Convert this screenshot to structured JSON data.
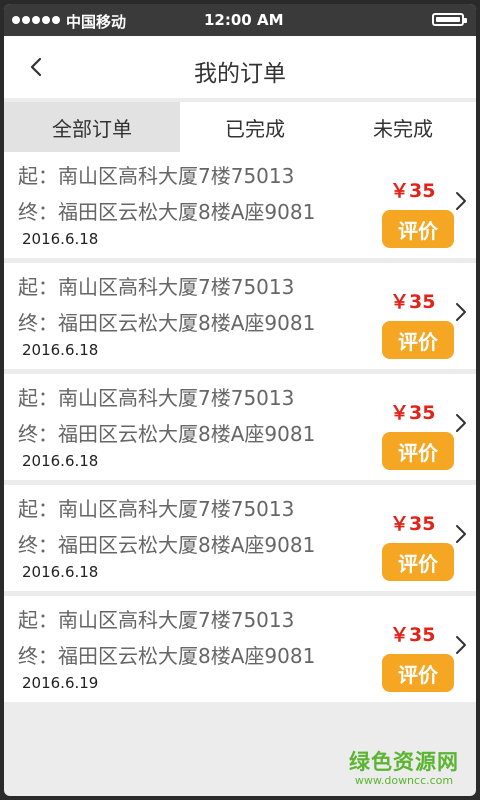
{
  "status_bar": {
    "carrier": "中国移动",
    "time": "12:00 AM",
    "battery_level": 1.0
  },
  "header": {
    "back_icon": "chevron-left-icon",
    "title": "我的订单"
  },
  "tabs": [
    {
      "label": "全部订单",
      "active": true
    },
    {
      "label": "已完成",
      "active": false
    },
    {
      "label": "未完成",
      "active": false
    }
  ],
  "orders": [
    {
      "from": "起：南山区高科大厦7楼75013",
      "to": "终：福田区云松大厦8楼A座9081",
      "date": "2016.6.18",
      "price": "￥35",
      "action": "评价"
    },
    {
      "from": "起：南山区高科大厦7楼75013",
      "to": "终：福田区云松大厦8楼A座9081",
      "date": "2016.6.18",
      "price": "￥35",
      "action": "评价"
    },
    {
      "from": "起：南山区高科大厦7楼75013",
      "to": "终：福田区云松大厦8楼A座9081",
      "date": "2016.6.18",
      "price": "￥35",
      "action": "评价"
    },
    {
      "from": "起：南山区高科大厦7楼75013",
      "to": "终：福田区云松大厦8楼A座9081",
      "date": "2016.6.18",
      "price": "￥35",
      "action": "评价"
    },
    {
      "from": "起：南山区高科大厦7楼75013",
      "to": "终：福田区云松大厦8楼A座9081",
      "date": "2016.6.19",
      "price": "￥35",
      "action": "评价"
    }
  ],
  "watermark": {
    "main": "绿色资源网",
    "sub": "www.downcc.com"
  },
  "colors": {
    "price": "#e2231a",
    "rate_button": "#f5a623",
    "active_tab": "#e2e2e2",
    "watermark": "#5cb531"
  }
}
